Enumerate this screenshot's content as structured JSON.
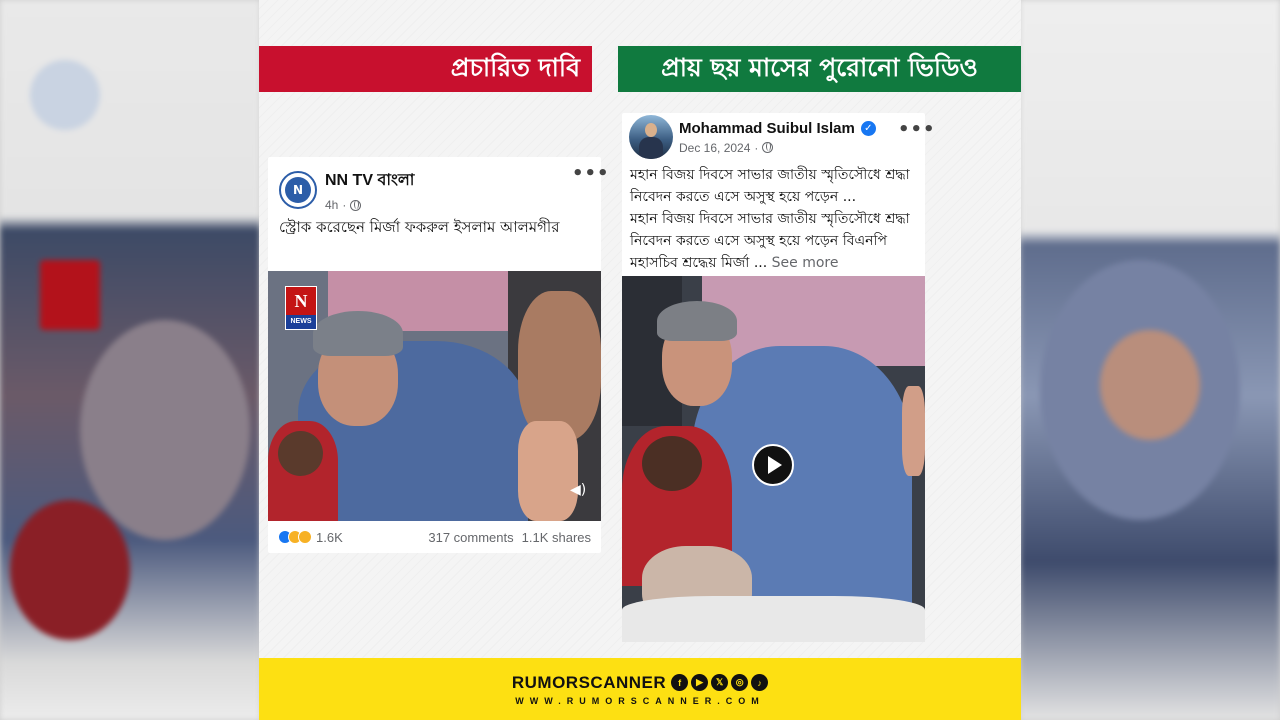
{
  "banners": {
    "claim": "প্রচারিত দাবি",
    "fact": "প্রায় ছয় মাসের পুরোনো ভিডিও"
  },
  "left_post": {
    "page_name": "NN TV বাংলা",
    "avatar_text": "N",
    "time": "4h",
    "text": "স্ট্রোক করেছেন মির্জা ফকরুল ইসলাম আলমগীর",
    "logo_letter": "N",
    "logo_caption": "NEWS",
    "reaction_count": "1.6K",
    "comments": "317 comments",
    "shares": "1.1K shares",
    "more_icon": "more-dots-icon",
    "sound_icon": "speaker-icon"
  },
  "right_post": {
    "author": "Mohammad Suibul Islam",
    "verified_mark": "✓",
    "date": "Dec 16, 2024",
    "text_line1": "মহান বিজয় দিবসে সাভার জাতীয় স্মৃতিসৌধে শ্রদ্ধা নিবেদন করতে এসে অসুস্থ হয়ে পড়েন ...",
    "text_line2": "মহান বিজয় দিবসে সাভার জাতীয় স্মৃতিসৌধে শ্রদ্ধা নিবেদন করতে এসে অসুস্থ হয়ে পড়েন বিএনপি মহাসচিব শ্রদ্ধেয় মির্জা ...",
    "see_more": "See more",
    "play_icon": "play-icon"
  },
  "footer": {
    "brand": "RUMORSCANNER",
    "site": "WWW.RUMORSCANNER.COM",
    "social": [
      "f",
      "▶",
      "𝕏",
      "◎",
      "♪"
    ]
  }
}
